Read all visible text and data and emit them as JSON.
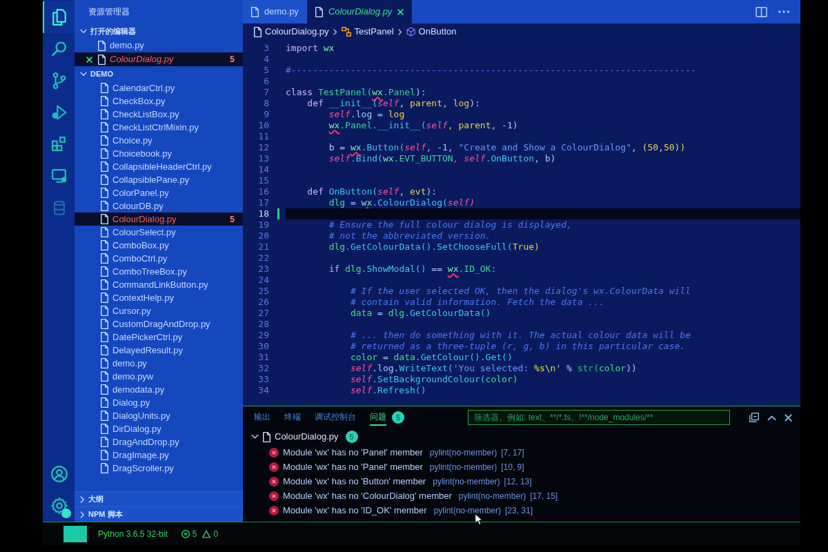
{
  "activity_bar": {
    "items": [
      {
        "kind": "explorer",
        "selected": true
      },
      {
        "kind": "search",
        "selected": false
      },
      {
        "kind": "source_control",
        "selected": false
      },
      {
        "kind": "run",
        "selected": false
      },
      {
        "kind": "extensions",
        "selected": false
      },
      {
        "kind": "remote",
        "selected": false
      },
      {
        "kind": "database",
        "selected": false
      }
    ],
    "bottom_items": [
      {
        "kind": "account",
        "badge": false
      },
      {
        "kind": "settings",
        "badge": true
      }
    ]
  },
  "sidebar": {
    "title": "资源管理器",
    "sections": [
      {
        "kind": "open_editors",
        "label": "打开的编辑器",
        "expanded": true,
        "items": [
          {
            "name": "demo.py",
            "selected": false,
            "error": false,
            "preview": false,
            "close_button": false
          },
          {
            "name": "ColourDialog.py",
            "selected": true,
            "error": true,
            "preview": true,
            "close_button": true,
            "problems": "5"
          }
        ]
      },
      {
        "kind": "folder",
        "label": "DEMO",
        "expanded": true,
        "items": [
          {
            "name": "CalendarCtrl.py",
            "selected": false,
            "error": false
          },
          {
            "name": "CheckBox.py",
            "selected": false,
            "error": false
          },
          {
            "name": "CheckListBox.py",
            "selected": false,
            "error": false
          },
          {
            "name": "CheckListCtrlMixin.py",
            "selected": false,
            "error": false
          },
          {
            "name": "Choice.py",
            "selected": false,
            "error": false
          },
          {
            "name": "Choicebook.py",
            "selected": false,
            "error": false
          },
          {
            "name": "CollapsibleHeaderCtrl.py",
            "selected": false,
            "error": false
          },
          {
            "name": "CollapsiblePane.py",
            "selected": false,
            "error": false
          },
          {
            "name": "ColorPanel.py",
            "selected": false,
            "error": false
          },
          {
            "name": "ColourDB.py",
            "selected": false,
            "error": false
          },
          {
            "name": "ColourDialog.py",
            "selected": true,
            "error": true,
            "problems": "5"
          },
          {
            "name": "ColourSelect.py",
            "selected": false,
            "error": false
          },
          {
            "name": "ComboBox.py",
            "selected": false,
            "error": false
          },
          {
            "name": "ComboCtrl.py",
            "selected": false,
            "error": false
          },
          {
            "name": "ComboTreeBox.py",
            "selected": false,
            "error": false
          },
          {
            "name": "CommandLinkButton.py",
            "selected": false,
            "error": false
          },
          {
            "name": "ContextHelp.py",
            "selected": false,
            "error": false
          },
          {
            "name": "Cursor.py",
            "selected": false,
            "error": false
          },
          {
            "name": "CustomDragAndDrop.py",
            "selected": false,
            "error": false
          },
          {
            "name": "DatePickerCtrl.py",
            "selected": false,
            "error": false
          },
          {
            "name": "DelayedResult.py",
            "selected": false,
            "error": false
          },
          {
            "name": "demo.py",
            "selected": false,
            "error": false
          },
          {
            "name": "demo.pyw",
            "selected": false,
            "error": false
          },
          {
            "name": "demodata.py",
            "selected": false,
            "error": false
          },
          {
            "name": "Dialog.py",
            "selected": false,
            "error": false
          },
          {
            "name": "DialogUnits.py",
            "selected": false,
            "error": false
          },
          {
            "name": "DirDialog.py",
            "selected": false,
            "error": false
          },
          {
            "name": "DragAndDrop.py",
            "selected": false,
            "error": false
          },
          {
            "name": "DragImage.py",
            "selected": false,
            "error": false
          },
          {
            "name": "DragScroller.py",
            "selected": false,
            "error": false
          }
        ]
      },
      {
        "kind": "view",
        "label": "大纲",
        "expanded": false
      },
      {
        "kind": "view",
        "label": "NPM 脚本",
        "expanded": false
      }
    ]
  },
  "editor": {
    "tabs": [
      {
        "label": "demo.py",
        "selected": false,
        "preview": false
      },
      {
        "label": "ColourDialog.py",
        "selected": true,
        "preview": true
      }
    ],
    "breadcrumb": [
      {
        "kind": "file",
        "label": "ColourDialog.py"
      },
      {
        "kind": "class",
        "label": "TestPanel"
      },
      {
        "kind": "method",
        "label": "OnButton"
      }
    ],
    "lines": [
      {
        "number": "3",
        "current": false,
        "modified": false,
        "tokens": [
          {
            "kind": "keyword",
            "text": "import",
            "error": false
          },
          {
            "kind": "module",
            "text": " wx",
            "error": false
          }
        ]
      },
      {
        "number": "4",
        "current": false,
        "modified": false
      },
      {
        "number": "5",
        "current": false,
        "modified": false,
        "tokens": [
          {
            "kind": "comment",
            "text": "#---------------------------------------------------------------------------",
            "error": false
          }
        ]
      },
      {
        "number": "6",
        "current": false,
        "modified": false
      },
      {
        "number": "7",
        "current": false,
        "modified": false,
        "tokens": [
          {
            "kind": "keyword",
            "text": "class",
            "error": false
          },
          {
            "kind": "class",
            "text": " TestPanel(",
            "error": false
          },
          {
            "kind": "module",
            "text": "wx",
            "error": true
          },
          {
            "kind": "class",
            "text": ".Panel",
            "error": false
          },
          {
            "kind": "plain",
            "text": "):",
            "error": false
          }
        ]
      },
      {
        "number": "8",
        "current": false,
        "modified": false,
        "tokens": [
          {
            "kind": "keyword",
            "text": "    def",
            "error": false
          },
          {
            "kind": "function",
            "text": " __init__(",
            "error": false
          },
          {
            "kind": "self",
            "text": "self",
            "error": false
          },
          {
            "kind": "param",
            "text": ", parent",
            "error": false
          },
          {
            "kind": "param",
            "text": ", log",
            "error": false
          },
          {
            "kind": "plain",
            "text": "):",
            "error": false
          }
        ]
      },
      {
        "number": "9",
        "current": false,
        "modified": false,
        "tokens": [
          {
            "kind": "self",
            "text": "        self",
            "error": false
          },
          {
            "kind": "plain",
            "text": ".log = ",
            "error": false
          },
          {
            "kind": "param",
            "text": "log",
            "error": false
          }
        ]
      },
      {
        "number": "10",
        "current": false,
        "modified": false,
        "tokens": [
          {
            "kind": "module",
            "text": "        wx",
            "error": true
          },
          {
            "kind": "class",
            "text": ".Panel",
            "error": false
          },
          {
            "kind": "function",
            "text": ".__init__(",
            "error": false
          },
          {
            "kind": "self",
            "text": "self",
            "error": false
          },
          {
            "kind": "param",
            "text": ", parent",
            "error": false
          },
          {
            "kind": "plain",
            "text": ", -1)",
            "error": false
          }
        ]
      },
      {
        "number": "11",
        "current": false,
        "modified": false
      },
      {
        "number": "12",
        "current": false,
        "modified": false,
        "tokens": [
          {
            "kind": "plain",
            "text": "        b = ",
            "error": false
          },
          {
            "kind": "module",
            "text": "wx",
            "error": true
          },
          {
            "kind": "function",
            "text": ".Button(",
            "error": false
          },
          {
            "kind": "self",
            "text": "self",
            "error": false
          },
          {
            "kind": "plain",
            "text": ", -1, ",
            "error": false
          },
          {
            "kind": "string",
            "text": "\"Create and Show a ColourDialog\"",
            "error": false
          },
          {
            "kind": "number",
            "text": ", (50,50))",
            "error": false
          }
        ]
      },
      {
        "number": "13",
        "current": false,
        "modified": false,
        "tokens": [
          {
            "kind": "self",
            "text": "        self",
            "error": false
          },
          {
            "kind": "function",
            "text": ".Bind(",
            "error": false
          },
          {
            "kind": "module",
            "text": "wx",
            "error": false
          },
          {
            "kind": "constant",
            "text": ".EVT_BUTTON",
            "error": false
          },
          {
            "kind": "self",
            "text": ", self",
            "error": false
          },
          {
            "kind": "function",
            "text": ".OnButton",
            "error": false
          },
          {
            "kind": "plain",
            "text": ", b)",
            "error": false
          }
        ]
      },
      {
        "number": "14",
        "current": false,
        "modified": false
      },
      {
        "number": "15",
        "current": false,
        "modified": false
      },
      {
        "number": "16",
        "current": false,
        "modified": false,
        "tokens": [
          {
            "kind": "keyword",
            "text": "    def",
            "error": false
          },
          {
            "kind": "function",
            "text": " OnButton(",
            "error": false
          },
          {
            "kind": "self",
            "text": "self",
            "error": false
          },
          {
            "kind": "param",
            "text": ", evt",
            "error": false
          },
          {
            "kind": "plain",
            "text": "):",
            "error": false
          }
        ]
      },
      {
        "number": "17",
        "current": false,
        "modified": false,
        "tokens": [
          {
            "kind": "variable",
            "text": "        dlg",
            "error": false
          },
          {
            "kind": "plain",
            "text": " = ",
            "error": false
          },
          {
            "kind": "module",
            "text": "wx",
            "error": true
          },
          {
            "kind": "function",
            "text": ".ColourDialog(",
            "error": false
          },
          {
            "kind": "self",
            "text": "self)",
            "error": false
          }
        ]
      },
      {
        "number": "18",
        "current": true,
        "modified": true
      },
      {
        "number": "19",
        "current": false,
        "modified": false,
        "tokens": [
          {
            "kind": "comment",
            "text": "        # Ensure the full colour dialog is displayed,",
            "error": false
          }
        ]
      },
      {
        "number": "20",
        "current": false,
        "modified": false,
        "tokens": [
          {
            "kind": "comment",
            "text": "        # not the abbreviated version.",
            "error": false
          }
        ]
      },
      {
        "number": "21",
        "current": false,
        "modified": false,
        "tokens": [
          {
            "kind": "variable",
            "text": "        dlg",
            "error": false
          },
          {
            "kind": "function",
            "text": ".GetColourData().SetChooseFull(",
            "error": false
          },
          {
            "kind": "boolean",
            "text": "True)",
            "error": false
          }
        ]
      },
      {
        "number": "22",
        "current": false,
        "modified": false
      },
      {
        "number": "23",
        "current": false,
        "modified": false,
        "tokens": [
          {
            "kind": "keyword",
            "text": "        if",
            "error": false
          },
          {
            "kind": "variable",
            "text": " dlg",
            "error": false
          },
          {
            "kind": "function",
            "text": ".ShowModal()",
            "error": false
          },
          {
            "kind": "plain",
            "text": " == ",
            "error": false
          },
          {
            "kind": "module",
            "text": "wx",
            "error": true
          },
          {
            "kind": "constant",
            "text": ".ID_OK:",
            "error": false
          }
        ]
      },
      {
        "number": "24",
        "current": false,
        "modified": false
      },
      {
        "number": "25",
        "current": false,
        "modified": false,
        "tokens": [
          {
            "kind": "comment",
            "text": "            # If the user selected OK, then the dialog's wx.ColourData will",
            "error": false
          }
        ]
      },
      {
        "number": "26",
        "current": false,
        "modified": false,
        "tokens": [
          {
            "kind": "comment",
            "text": "            # contain valid information. Fetch the data ...",
            "error": false
          }
        ]
      },
      {
        "number": "27",
        "current": false,
        "modified": false,
        "tokens": [
          {
            "kind": "variable",
            "text": "            data",
            "error": false
          },
          {
            "kind": "plain",
            "text": " = ",
            "error": false
          },
          {
            "kind": "variable",
            "text": "dlg",
            "error": false
          },
          {
            "kind": "function",
            "text": ".GetColourData()",
            "error": false
          }
        ]
      },
      {
        "number": "28",
        "current": false,
        "modified": false
      },
      {
        "number": "29",
        "current": false,
        "modified": false,
        "tokens": [
          {
            "kind": "comment",
            "text": "            # ... then do something with it. The actual colour data will be",
            "error": false
          }
        ]
      },
      {
        "number": "30",
        "current": false,
        "modified": false,
        "tokens": [
          {
            "kind": "comment",
            "text": "            # returned as a three-tuple (r, g, b) in this particular case.",
            "error": false
          }
        ]
      },
      {
        "number": "31",
        "current": false,
        "modified": false,
        "tokens": [
          {
            "kind": "variable",
            "text": "            color",
            "error": false
          },
          {
            "kind": "plain",
            "text": " = ",
            "error": false
          },
          {
            "kind": "variable",
            "text": "data",
            "error": false
          },
          {
            "kind": "function",
            "text": ".GetColour().Get()",
            "error": false
          }
        ]
      },
      {
        "number": "32",
        "current": false,
        "modified": false,
        "tokens": [
          {
            "kind": "self",
            "text": "            self",
            "error": false
          },
          {
            "kind": "plain",
            "text": ".log.",
            "error": false
          },
          {
            "kind": "function",
            "text": "WriteText(",
            "error": false
          },
          {
            "kind": "string",
            "text": "'You selected: ",
            "error": false
          },
          {
            "kind": "escape",
            "text": "%s\\n",
            "error": false
          },
          {
            "kind": "plain",
            "text": "' % ",
            "error": false
          },
          {
            "kind": "builtin",
            "text": "str(",
            "error": false
          },
          {
            "kind": "variable",
            "text": "color",
            "error": false
          },
          {
            "kind": "plain",
            "text": "))",
            "error": false
          }
        ]
      },
      {
        "number": "33",
        "current": false,
        "modified": false,
        "tokens": [
          {
            "kind": "self",
            "text": "            self",
            "error": false
          },
          {
            "kind": "function",
            "text": ".SetBackgroundColour(",
            "error": false
          },
          {
            "kind": "variable",
            "text": "color)",
            "error": false
          }
        ]
      },
      {
        "number": "34",
        "current": false,
        "modified": false,
        "tokens": [
          {
            "kind": "self",
            "text": "            self",
            "error": false
          },
          {
            "kind": "function",
            "text": ".Refresh()",
            "error": false
          }
        ]
      }
    ]
  },
  "panel": {
    "tabs": [
      {
        "label": "输出",
        "selected": false
      },
      {
        "label": "终端",
        "selected": false
      },
      {
        "label": "调试控制台",
        "selected": false
      },
      {
        "label": "问题",
        "selected": true,
        "badge": "5"
      }
    ],
    "filter": {
      "placeholder": "筛选器。例如: text、**/*.ts、!**/node_modules/**"
    },
    "problems": {
      "file": "ColourDialog.py",
      "count": "5",
      "expanded": true,
      "items": [
        {
          "kind": "error",
          "message": "Module 'wx' has no 'Panel' member",
          "source": "pylint(no-member)",
          "location": "[7, 17]"
        },
        {
          "kind": "error",
          "message": "Module 'wx' has no 'Panel' member",
          "source": "pylint(no-member)",
          "location": "[10, 9]"
        },
        {
          "kind": "error",
          "message": "Module 'wx' has no 'Button' member",
          "source": "pylint(no-member)",
          "location": "[12, 13]"
        },
        {
          "kind": "error",
          "message": "Module 'wx' has no 'ColourDialog' member",
          "source": "pylint(no-member)",
          "location": "[17, 15]"
        },
        {
          "kind": "error",
          "message": "Module 'wx' has no 'ID_OK' member",
          "source": "pylint(no-member)",
          "location": "[23, 31]"
        }
      ]
    }
  },
  "status_bar": {
    "interpreter": "Python 3.6.5 32-bit",
    "errors": "5",
    "warnings": "0"
  }
}
